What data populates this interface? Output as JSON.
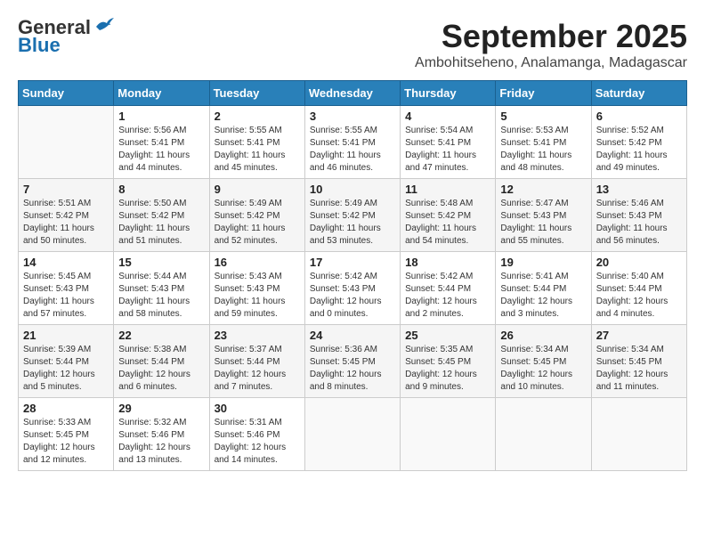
{
  "header": {
    "logo_line1": "General",
    "logo_line2": "Blue",
    "month": "September 2025",
    "location": "Ambohitseheno, Analamanga, Madagascar"
  },
  "weekdays": [
    "Sunday",
    "Monday",
    "Tuesday",
    "Wednesday",
    "Thursday",
    "Friday",
    "Saturday"
  ],
  "weeks": [
    [
      {
        "day": "",
        "sunrise": "",
        "sunset": "",
        "daylight": ""
      },
      {
        "day": "1",
        "sunrise": "Sunrise: 5:56 AM",
        "sunset": "Sunset: 5:41 PM",
        "daylight": "Daylight: 11 hours and 44 minutes."
      },
      {
        "day": "2",
        "sunrise": "Sunrise: 5:55 AM",
        "sunset": "Sunset: 5:41 PM",
        "daylight": "Daylight: 11 hours and 45 minutes."
      },
      {
        "day": "3",
        "sunrise": "Sunrise: 5:55 AM",
        "sunset": "Sunset: 5:41 PM",
        "daylight": "Daylight: 11 hours and 46 minutes."
      },
      {
        "day": "4",
        "sunrise": "Sunrise: 5:54 AM",
        "sunset": "Sunset: 5:41 PM",
        "daylight": "Daylight: 11 hours and 47 minutes."
      },
      {
        "day": "5",
        "sunrise": "Sunrise: 5:53 AM",
        "sunset": "Sunset: 5:41 PM",
        "daylight": "Daylight: 11 hours and 48 minutes."
      },
      {
        "day": "6",
        "sunrise": "Sunrise: 5:52 AM",
        "sunset": "Sunset: 5:42 PM",
        "daylight": "Daylight: 11 hours and 49 minutes."
      }
    ],
    [
      {
        "day": "7",
        "sunrise": "Sunrise: 5:51 AM",
        "sunset": "Sunset: 5:42 PM",
        "daylight": "Daylight: 11 hours and 50 minutes."
      },
      {
        "day": "8",
        "sunrise": "Sunrise: 5:50 AM",
        "sunset": "Sunset: 5:42 PM",
        "daylight": "Daylight: 11 hours and 51 minutes."
      },
      {
        "day": "9",
        "sunrise": "Sunrise: 5:49 AM",
        "sunset": "Sunset: 5:42 PM",
        "daylight": "Daylight: 11 hours and 52 minutes."
      },
      {
        "day": "10",
        "sunrise": "Sunrise: 5:49 AM",
        "sunset": "Sunset: 5:42 PM",
        "daylight": "Daylight: 11 hours and 53 minutes."
      },
      {
        "day": "11",
        "sunrise": "Sunrise: 5:48 AM",
        "sunset": "Sunset: 5:42 PM",
        "daylight": "Daylight: 11 hours and 54 minutes."
      },
      {
        "day": "12",
        "sunrise": "Sunrise: 5:47 AM",
        "sunset": "Sunset: 5:43 PM",
        "daylight": "Daylight: 11 hours and 55 minutes."
      },
      {
        "day": "13",
        "sunrise": "Sunrise: 5:46 AM",
        "sunset": "Sunset: 5:43 PM",
        "daylight": "Daylight: 11 hours and 56 minutes."
      }
    ],
    [
      {
        "day": "14",
        "sunrise": "Sunrise: 5:45 AM",
        "sunset": "Sunset: 5:43 PM",
        "daylight": "Daylight: 11 hours and 57 minutes."
      },
      {
        "day": "15",
        "sunrise": "Sunrise: 5:44 AM",
        "sunset": "Sunset: 5:43 PM",
        "daylight": "Daylight: 11 hours and 58 minutes."
      },
      {
        "day": "16",
        "sunrise": "Sunrise: 5:43 AM",
        "sunset": "Sunset: 5:43 PM",
        "daylight": "Daylight: 11 hours and 59 minutes."
      },
      {
        "day": "17",
        "sunrise": "Sunrise: 5:42 AM",
        "sunset": "Sunset: 5:43 PM",
        "daylight": "Daylight: 12 hours and 0 minutes."
      },
      {
        "day": "18",
        "sunrise": "Sunrise: 5:42 AM",
        "sunset": "Sunset: 5:44 PM",
        "daylight": "Daylight: 12 hours and 2 minutes."
      },
      {
        "day": "19",
        "sunrise": "Sunrise: 5:41 AM",
        "sunset": "Sunset: 5:44 PM",
        "daylight": "Daylight: 12 hours and 3 minutes."
      },
      {
        "day": "20",
        "sunrise": "Sunrise: 5:40 AM",
        "sunset": "Sunset: 5:44 PM",
        "daylight": "Daylight: 12 hours and 4 minutes."
      }
    ],
    [
      {
        "day": "21",
        "sunrise": "Sunrise: 5:39 AM",
        "sunset": "Sunset: 5:44 PM",
        "daylight": "Daylight: 12 hours and 5 minutes."
      },
      {
        "day": "22",
        "sunrise": "Sunrise: 5:38 AM",
        "sunset": "Sunset: 5:44 PM",
        "daylight": "Daylight: 12 hours and 6 minutes."
      },
      {
        "day": "23",
        "sunrise": "Sunrise: 5:37 AM",
        "sunset": "Sunset: 5:44 PM",
        "daylight": "Daylight: 12 hours and 7 minutes."
      },
      {
        "day": "24",
        "sunrise": "Sunrise: 5:36 AM",
        "sunset": "Sunset: 5:45 PM",
        "daylight": "Daylight: 12 hours and 8 minutes."
      },
      {
        "day": "25",
        "sunrise": "Sunrise: 5:35 AM",
        "sunset": "Sunset: 5:45 PM",
        "daylight": "Daylight: 12 hours and 9 minutes."
      },
      {
        "day": "26",
        "sunrise": "Sunrise: 5:34 AM",
        "sunset": "Sunset: 5:45 PM",
        "daylight": "Daylight: 12 hours and 10 minutes."
      },
      {
        "day": "27",
        "sunrise": "Sunrise: 5:34 AM",
        "sunset": "Sunset: 5:45 PM",
        "daylight": "Daylight: 12 hours and 11 minutes."
      }
    ],
    [
      {
        "day": "28",
        "sunrise": "Sunrise: 5:33 AM",
        "sunset": "Sunset: 5:45 PM",
        "daylight": "Daylight: 12 hours and 12 minutes."
      },
      {
        "day": "29",
        "sunrise": "Sunrise: 5:32 AM",
        "sunset": "Sunset: 5:46 PM",
        "daylight": "Daylight: 12 hours and 13 minutes."
      },
      {
        "day": "30",
        "sunrise": "Sunrise: 5:31 AM",
        "sunset": "Sunset: 5:46 PM",
        "daylight": "Daylight: 12 hours and 14 minutes."
      },
      {
        "day": "",
        "sunrise": "",
        "sunset": "",
        "daylight": ""
      },
      {
        "day": "",
        "sunrise": "",
        "sunset": "",
        "daylight": ""
      },
      {
        "day": "",
        "sunrise": "",
        "sunset": "",
        "daylight": ""
      },
      {
        "day": "",
        "sunrise": "",
        "sunset": "",
        "daylight": ""
      }
    ]
  ]
}
